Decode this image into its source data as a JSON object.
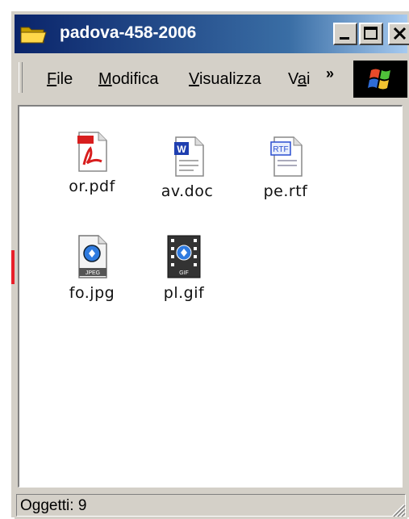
{
  "window": {
    "title": "padova-458-2006",
    "icon": "folder-icon",
    "controls": [
      "minimize",
      "maximize",
      "close"
    ]
  },
  "menubar": {
    "items": [
      {
        "label": "File",
        "access_key": "F"
      },
      {
        "label": "Modifica",
        "access_key": "M"
      },
      {
        "label": "Visualizza",
        "access_key": "V"
      },
      {
        "label": "Vai",
        "access_key": "a"
      }
    ],
    "overflow_glyph": "»"
  },
  "files": [
    {
      "name": "or.pdf",
      "icon": "pdf-file-icon"
    },
    {
      "name": "av.doc",
      "icon": "word-doc-icon"
    },
    {
      "name": "pe.rtf",
      "icon": "rtf-file-icon"
    },
    {
      "name": "fo.jpg",
      "icon": "jpg-image-icon"
    },
    {
      "name": "pl.gif",
      "icon": "gif-image-icon"
    }
  ],
  "statusbar": {
    "text": "Oggetti: 9"
  },
  "colors": {
    "titlebar_start": "#0a246a",
    "titlebar_end": "#a6caf0",
    "chrome": "#d4d0c8",
    "content_bg": "#ffffff"
  }
}
